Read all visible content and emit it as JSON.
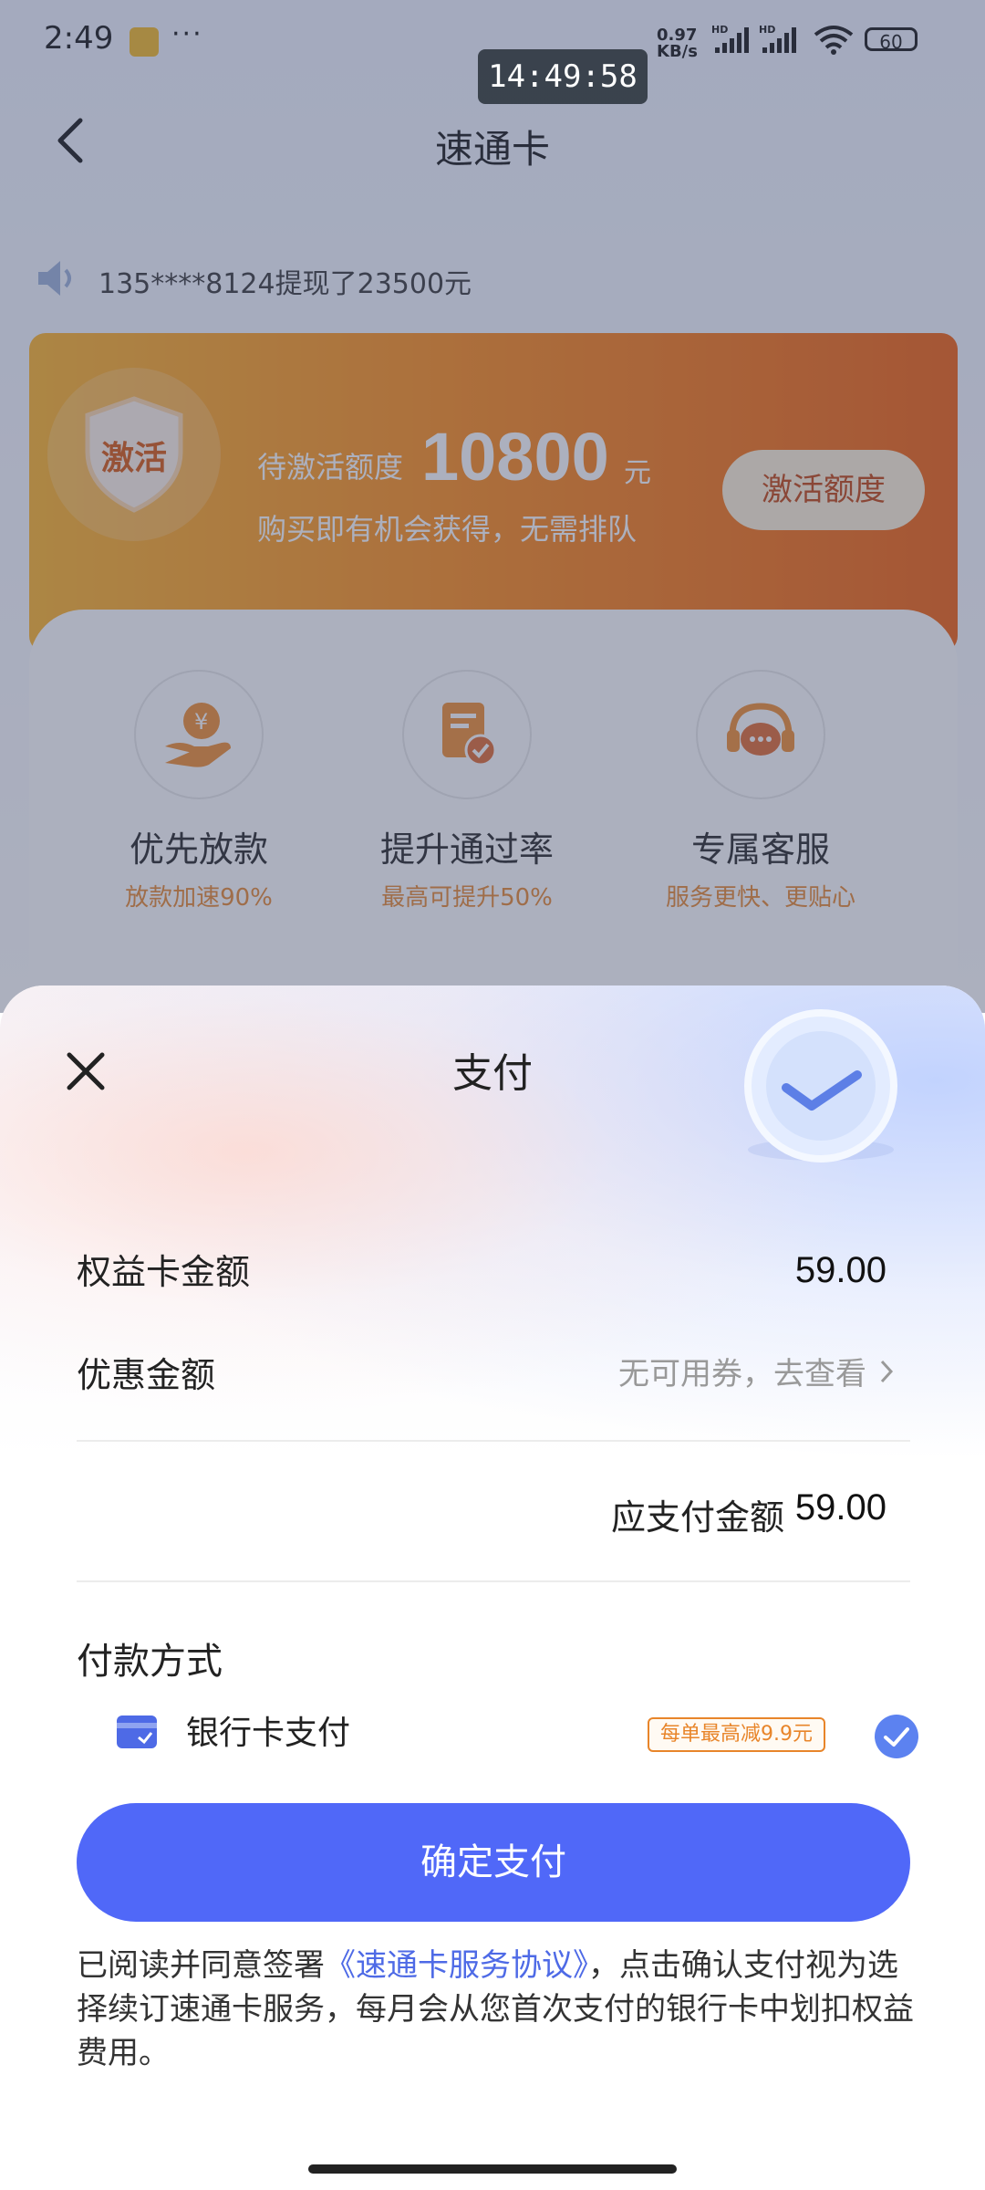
{
  "status_bar": {
    "time": "2:49",
    "dots": "···",
    "net_speed_top": "0.97",
    "net_speed_bottom": "KB/s",
    "hd1": "HD",
    "hd2": "HD",
    "battery": "60"
  },
  "clock_overlay": "14:49:58",
  "nav": {
    "title": "速通卡"
  },
  "ticker": {
    "text": "135****8124提现了23500元"
  },
  "quota_card": {
    "shield_label": "激活",
    "label": "待激活额度",
    "amount": "10800",
    "unit": "元",
    "subtitle": "购买即有机会获得，无需排队",
    "button": "激活额度"
  },
  "benefits": [
    {
      "title": "优先放款",
      "subtitle": "放款加速90%",
      "icon": "money-hand-icon"
    },
    {
      "title": "提升通过率",
      "subtitle": "最高可提升50%",
      "icon": "document-check-icon"
    },
    {
      "title": "专属客服",
      "subtitle": "服务更快、更贴心",
      "icon": "headset-chat-icon"
    }
  ],
  "payment_sheet": {
    "title": "支付",
    "card_amount_label": "权益卡金额",
    "card_amount_value": "59.00",
    "discount_label": "优惠金额",
    "discount_value": "无可用券，去查看",
    "payable_label": "应支付金额",
    "payable_value": "59.00",
    "method_title": "付款方式",
    "method": {
      "label": "银行卡支付",
      "promo": "每单最高减9.9元",
      "selected": true
    },
    "confirm_button": "确定支付",
    "agreement_prefix": "已阅读并同意签署",
    "agreement_link": "《速通卡服务协议》",
    "agreement_suffix": "，点击确认支付视为选择续订速通卡服务，每月会从您首次支付的银行卡中划扣权益费用。"
  },
  "colors": {
    "primary": "#5068f8",
    "orange_start": "#ffb323",
    "orange_end": "#f25c08",
    "benefit_sub": "#e8852a",
    "link": "#4e6ae6"
  }
}
